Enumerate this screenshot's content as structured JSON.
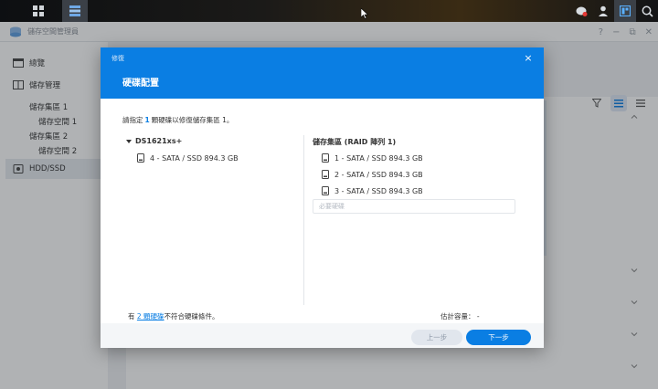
{
  "app": {
    "title": "儲存空間管理員"
  },
  "sidebar": {
    "items": [
      {
        "label": "總覽",
        "icon": "overview-icon"
      },
      {
        "label": "儲存管理",
        "icon": "storage-icon"
      },
      {
        "label": "HDD/SSD",
        "icon": "hdd-icon"
      }
    ],
    "sub": [
      {
        "label": "儲存集區 1"
      },
      {
        "label": "儲存空間 1"
      },
      {
        "label": "儲存集區 2"
      },
      {
        "label": "儲存空間 2"
      }
    ]
  },
  "modal": {
    "breadcrumb": "修復",
    "title": "硬碟配置",
    "close": "×",
    "instruction_prefix": "請指定",
    "instruction_count": "1",
    "instruction_suffix": "顆硬碟以修復儲存集區 1。",
    "left": {
      "device": "DS1621xs+",
      "disks": [
        {
          "label": "4 - SATA / SSD 894.3 GB"
        }
      ]
    },
    "right": {
      "pool": "儲存集區 (RAID 陣列 1)",
      "disks": [
        {
          "label": "1 - SATA / SSD 894.3 GB"
        },
        {
          "label": "2 - SATA / SSD 894.3 GB"
        },
        {
          "label": "3 - SATA / SSD 894.3 GB"
        }
      ],
      "required_placeholder": "必要硬碟"
    },
    "footer_prefix": "有",
    "footer_link": "2 顆硬碟",
    "footer_suffix": "不符合硬碟條件。",
    "capacity_label": "估計容量： -",
    "prev_button": "上一步",
    "next_button": "下一步"
  },
  "colors": {
    "accent": "#0a7ee3"
  }
}
